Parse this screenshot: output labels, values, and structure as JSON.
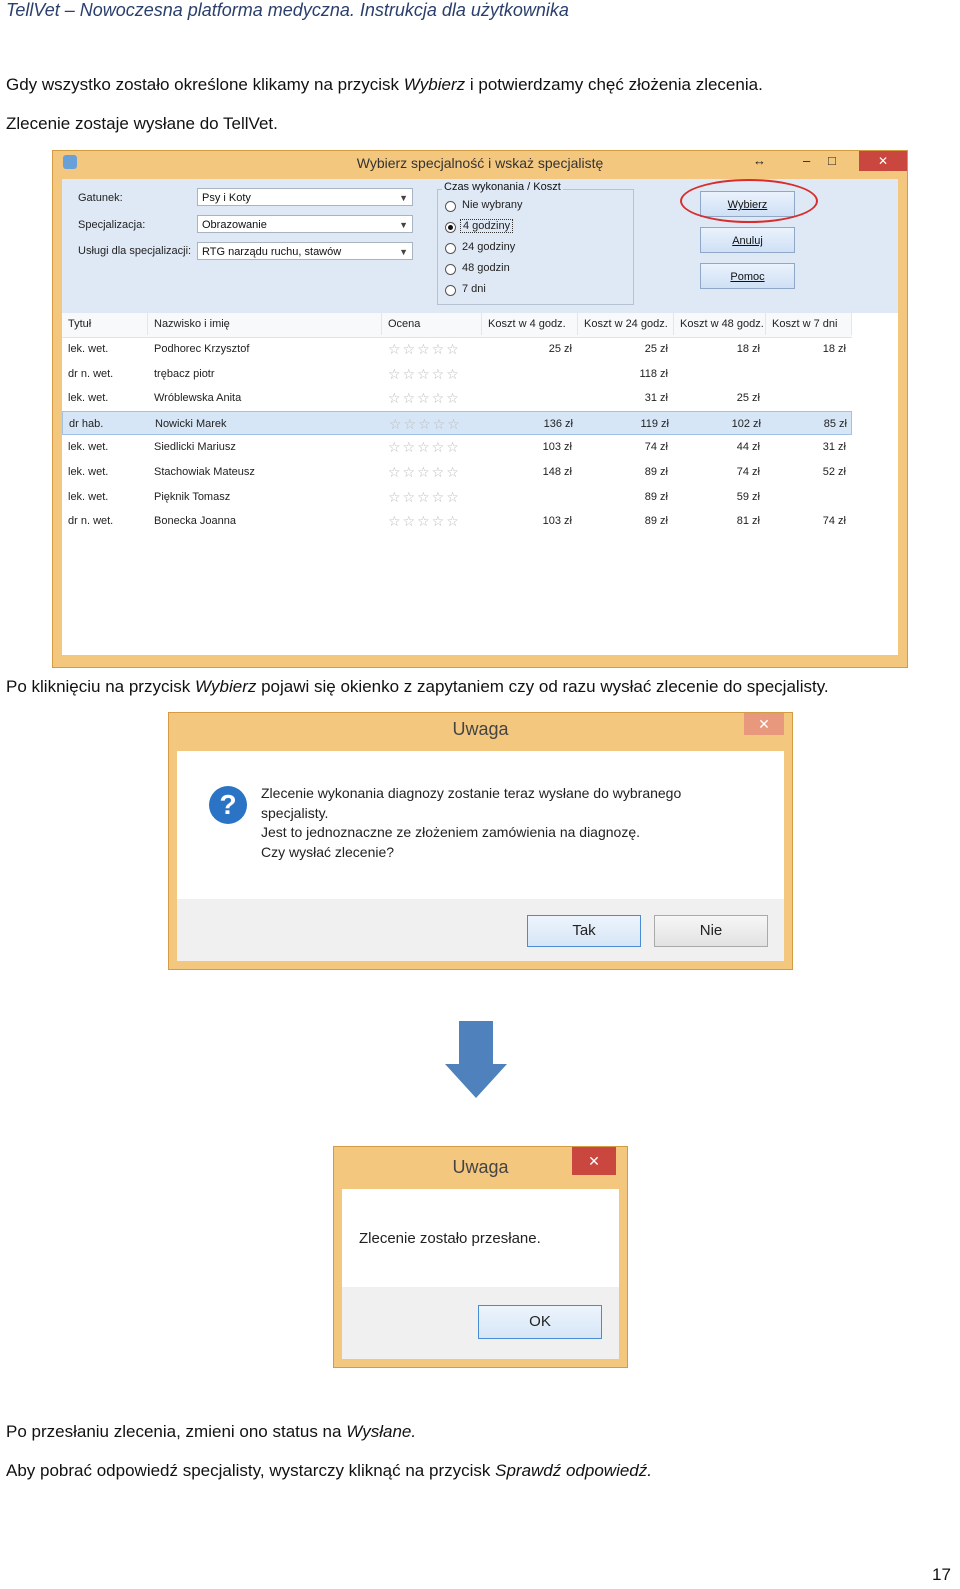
{
  "header": {
    "text": "TellVet – Nowoczesna platforma medyczna. Instrukcja dla użytkownika"
  },
  "para1": {
    "line1_pre": "Gdy wszystko zostało określone klikamy na przycisk ",
    "line1_em": "Wybierz",
    "line1_post": " i potwierdzamy chęć złożenia zlecenia.",
    "line2": "Zlecenie zostaje wysłane do TellVet."
  },
  "window1": {
    "title": "Wybierz specjalność i wskaż specjalistę",
    "controls": {
      "resize": "↔",
      "minimize": "–",
      "maximize": "□",
      "close": "✕"
    },
    "fields": [
      {
        "label": "Gatunek:",
        "value": "Psy i Koty"
      },
      {
        "label": "Specjalizacja:",
        "value": "Obrazowanie"
      },
      {
        "label": "Usługi dla specjalizacji:",
        "value": "RTG narządu ruchu, stawów"
      }
    ],
    "group_title": "Czas wykonania / Koszt",
    "radios": [
      "Nie wybrany",
      "4 godziny",
      "24 godziny",
      "48 godzin",
      "7 dni"
    ],
    "selected_radio": "4 godziny",
    "buttons": {
      "choose": "Wybierz",
      "cancel": "Anuluj",
      "help": "Pomoc"
    },
    "columns": [
      "Tytuł",
      "Nazwisko i imię",
      "Ocena",
      "Koszt w 4 godz.",
      "Koszt w 24 godz.",
      "Koszt w 48 godz.",
      "Koszt w 7 dni"
    ],
    "rows": [
      {
        "title": "lek. wet.",
        "name": "Podhorec Krzysztof",
        "c4": "25 zł",
        "c24": "25 zł",
        "c48": "18 zł",
        "c7": "18 zł"
      },
      {
        "title": "dr n. wet.",
        "name": "trębacz piotr",
        "c4": "",
        "c24": "118 zł",
        "c48": "",
        "c7": ""
      },
      {
        "title": "lek. wet.",
        "name": "Wróblewska Anita",
        "c4": "",
        "c24": "31 zł",
        "c48": "25 zł",
        "c7": ""
      },
      {
        "title": "dr hab.",
        "name": "Nowicki Marek",
        "c4": "136 zł",
        "c24": "119 zł",
        "c48": "102 zł",
        "c7": "85 zł"
      },
      {
        "title": "lek. wet.",
        "name": "Siedlicki Mariusz",
        "c4": "103 zł",
        "c24": "74 zł",
        "c48": "44 zł",
        "c7": "31 zł"
      },
      {
        "title": "lek. wet.",
        "name": "Stachowiak Mateusz",
        "c4": "148 zł",
        "c24": "89 zł",
        "c48": "74 zł",
        "c7": "52 zł"
      },
      {
        "title": "lek. wet.",
        "name": "Pięknik Tomasz",
        "c4": "",
        "c24": "89 zł",
        "c48": "59 zł",
        "c7": ""
      },
      {
        "title": "dr n. wet.",
        "name": "Bonecka Joanna",
        "c4": "103 zł",
        "c24": "89 zł",
        "c48": "81 zł",
        "c7": "74 zł"
      }
    ],
    "selected_row": "Nowicki Marek",
    "stars": "☆☆☆☆☆"
  },
  "para2": {
    "pre": "Po kliknięciu na przycisk ",
    "em": "Wybierz",
    "post": " pojawi się okienko z zapytaniem czy od razu wysłać zlecenie do specjalisty."
  },
  "dialog1": {
    "title": "Uwaga",
    "close": "✕",
    "icon": "?",
    "lines": [
      "Zlecenie wykonania diagnozy zostanie teraz wysłane do wybranego",
      "specjalisty.",
      "Jest to jednoznaczne ze złożeniem zamówienia na diagnozę.",
      "Czy wysłać zlecenie?"
    ],
    "yes": "Tak",
    "no": "Nie"
  },
  "dialog2": {
    "title": "Uwaga",
    "close": "✕",
    "message": "Zlecenie zostało przesłane.",
    "ok": "OK"
  },
  "para3": {
    "pre": "Po przesłaniu zlecenia, zmieni ono status na ",
    "em": "Wysłane."
  },
  "para4": {
    "pre": "Aby pobrać odpowiedź specjalisty, wystarczy kliknąć na przycisk ",
    "em": "Sprawdź odpowiedź."
  },
  "page_number": "17",
  "colors": {
    "window_frame": "#f4c77e",
    "close_red": "#c9473e",
    "highlight_oval": "#d82d2d",
    "arrow": "#4f81bd",
    "selected_row": "#d6e6f7"
  }
}
